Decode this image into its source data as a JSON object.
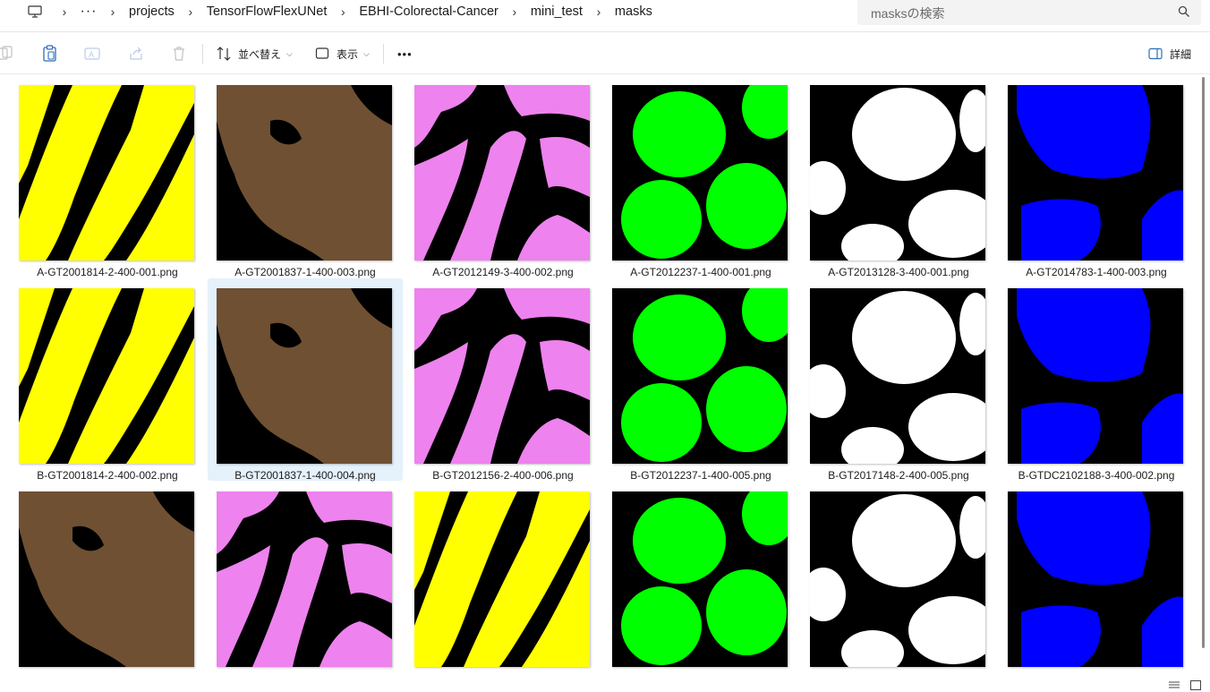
{
  "breadcrumb": {
    "more": "···",
    "segments": [
      "projects",
      "TensorFlowFlexUNet",
      "EBHI-Colorectal-Cancer",
      "mini_test",
      "masks"
    ]
  },
  "search": {
    "placeholder": "masksの検索"
  },
  "toolbar": {
    "sort_label": "並べ替え",
    "view_label": "表示",
    "more": "•••",
    "details_label": "詳細"
  },
  "colors": {
    "yellow": "#ffff00",
    "brown": "#6f5032",
    "pink": "#ee82ee",
    "green": "#00ff00",
    "white": "#ffffff",
    "blue": "#0000ff",
    "selection": "#e5f1fb"
  },
  "files": [
    {
      "name": "A-GT2001814-2-400-001.png",
      "color": "yellow"
    },
    {
      "name": "A-GT2001837-1-400-003.png",
      "color": "brown"
    },
    {
      "name": "A-GT2012149-3-400-002.png",
      "color": "pink"
    },
    {
      "name": "A-GT2012237-1-400-001.png",
      "color": "green"
    },
    {
      "name": "A-GT2013128-3-400-001.png",
      "color": "white"
    },
    {
      "name": "A-GT2014783-1-400-003.png",
      "color": "blue"
    },
    {
      "name": "B-GT2001814-2-400-002.png",
      "color": "yellow"
    },
    {
      "name": "B-GT2001837-1-400-004.png",
      "color": "brown",
      "selected": true
    },
    {
      "name": "B-GT2012156-2-400-006.png",
      "color": "pink"
    },
    {
      "name": "B-GT2012237-1-400-005.png",
      "color": "green"
    },
    {
      "name": "B-GT2017148-2-400-005.png",
      "color": "white"
    },
    {
      "name": "B-GTDC2102188-3-400-002.png",
      "color": "blue"
    },
    {
      "name": "",
      "color": "brown"
    },
    {
      "name": "",
      "color": "pink"
    },
    {
      "name": "",
      "color": "yellow"
    },
    {
      "name": "",
      "color": "green"
    },
    {
      "name": "",
      "color": "white"
    },
    {
      "name": "",
      "color": "blue"
    }
  ]
}
